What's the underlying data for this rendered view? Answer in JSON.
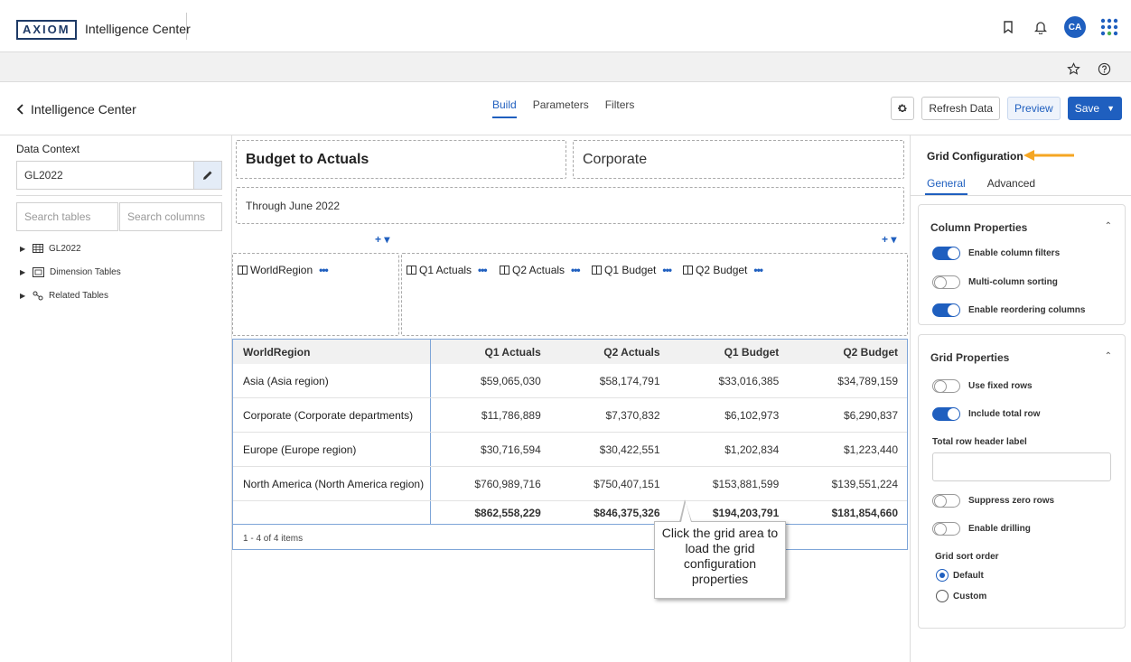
{
  "app": {
    "logo": "AXIOM",
    "title": "Intelligence Center",
    "user_initials": "CA"
  },
  "nav": {
    "back_label": "Intelligence Center",
    "tabs": [
      "Build",
      "Parameters",
      "Filters"
    ],
    "active_tab": "Build",
    "refresh_label": "Refresh Data",
    "preview_label": "Preview",
    "save_label": "Save"
  },
  "left_panel": {
    "title": "Data Context",
    "context_value": "GL2022",
    "search_tables_placeholder": "Search tables",
    "search_columns_placeholder": "Search columns",
    "tree": [
      {
        "label": "GL2022",
        "icon": "table-icon"
      },
      {
        "label": "Dimension Tables",
        "icon": "dimension-table-icon"
      },
      {
        "label": "Related Tables",
        "icon": "related-link-icon"
      }
    ]
  },
  "canvas": {
    "title": "Budget to Actuals",
    "entity": "Corporate",
    "subtitle": "Through June 2022",
    "plus_label": "+ ▾",
    "row_chips": [
      "WorldRegion"
    ],
    "column_chips": [
      "Q1 Actuals",
      "Q2 Actuals",
      "Q1 Budget",
      "Q2 Budget"
    ],
    "grid": {
      "headers": [
        "WorldRegion",
        "Q1 Actuals",
        "Q2 Actuals",
        "Q1 Budget",
        "Q2 Budget"
      ],
      "rows": [
        [
          "Asia (Asia region)",
          "$59,065,030",
          "$58,174,791",
          "$33,016,385",
          "$34,789,159"
        ],
        [
          "Corporate (Corporate departments)",
          "$11,786,889",
          "$7,370,832",
          "$6,102,973",
          "$6,290,837"
        ],
        [
          "Europe (Europe region)",
          "$30,716,594",
          "$30,422,551",
          "$1,202,834",
          "$1,223,440"
        ],
        [
          "North America (North America region)",
          "$760,989,716",
          "$750,407,151",
          "$153,881,599",
          "$139,551,224"
        ]
      ],
      "totals": [
        "",
        "$862,558,229",
        "$846,375,326",
        "$194,203,791",
        "$181,854,660"
      ],
      "footer": "1 - 4 of 4 items"
    },
    "callout": "Click the grid area to load the grid configuration properties"
  },
  "right_panel": {
    "title": "Grid Configuration",
    "tabs": [
      "General",
      "Advanced"
    ],
    "active_tab": "General",
    "column_properties": {
      "title": "Column Properties",
      "toggles": [
        {
          "label": "Enable column filters",
          "on": true
        },
        {
          "label": "Multi-column sorting",
          "on": false
        },
        {
          "label": "Enable reordering columns",
          "on": true
        }
      ]
    },
    "grid_properties": {
      "title": "Grid Properties",
      "toggles": [
        {
          "label": "Use fixed rows",
          "on": false
        },
        {
          "label": "Include total row",
          "on": true
        }
      ],
      "total_row_header_label": "Total row header label",
      "total_row_header_value": "",
      "toggles2": [
        {
          "label": "Suppress zero rows",
          "on": false
        },
        {
          "label": "Enable drilling",
          "on": false
        }
      ],
      "sort_order_label": "Grid sort order",
      "sort_options": [
        "Default",
        "Custom"
      ],
      "sort_selected": "Default"
    }
  },
  "colors": {
    "accent": "#1f5fbf",
    "arrow": "#f5a623"
  }
}
